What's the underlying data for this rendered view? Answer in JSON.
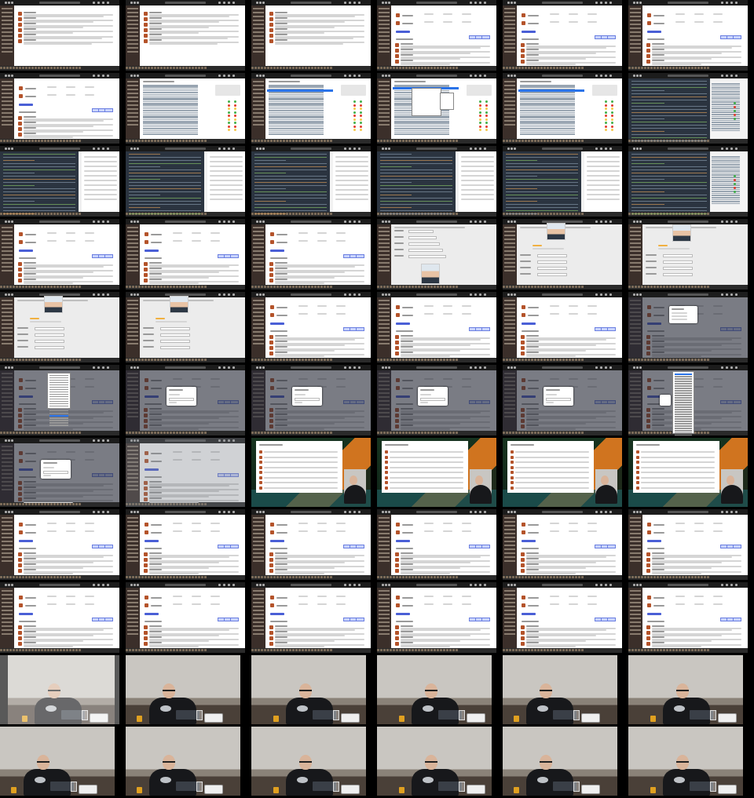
{
  "title": "",
  "layout": {
    "columns": 6,
    "rows": 11
  },
  "colors": {
    "background": "#000000",
    "sidebar": "#3b2f2a",
    "accent_button": "#4a5fd6",
    "code_editor": "#2b3440",
    "overlay": "#282c38",
    "avatar": "#b4532a",
    "presenter_hoodie": "#17181b"
  },
  "frames": [
    {
      "row": 1,
      "kind": "forum-thread"
    },
    {
      "row": 2,
      "kind": "forum-thread / file-browser"
    },
    {
      "row": 3,
      "kind": "code-editor"
    },
    {
      "row": 4,
      "kind": "forum-thread / profile-editor"
    },
    {
      "row": 5,
      "kind": "profile-editor / forum-thread / dialog"
    },
    {
      "row": 6,
      "kind": "modal-dialog"
    },
    {
      "row": 7,
      "kind": "modal-dialog / presenter-composite"
    },
    {
      "row": 8,
      "kind": "forum-thread"
    },
    {
      "row": 9,
      "kind": "forum-thread"
    },
    {
      "row": 10,
      "kind": "presenter-video"
    },
    {
      "row": 11,
      "kind": "presenter-video"
    }
  ]
}
